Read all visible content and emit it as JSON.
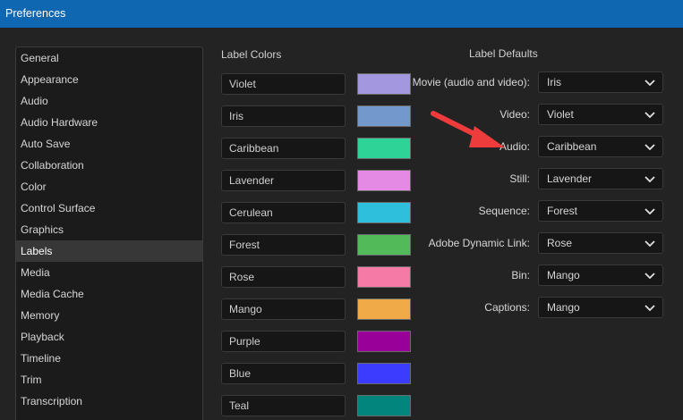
{
  "window": {
    "title": "Preferences"
  },
  "sidebar": {
    "items": [
      {
        "label": "General"
      },
      {
        "label": "Appearance"
      },
      {
        "label": "Audio"
      },
      {
        "label": "Audio Hardware"
      },
      {
        "label": "Auto Save"
      },
      {
        "label": "Collaboration"
      },
      {
        "label": "Color"
      },
      {
        "label": "Control Surface"
      },
      {
        "label": "Graphics"
      },
      {
        "label": "Labels"
      },
      {
        "label": "Media"
      },
      {
        "label": "Media Cache"
      },
      {
        "label": "Memory"
      },
      {
        "label": "Playback"
      },
      {
        "label": "Timeline"
      },
      {
        "label": "Trim"
      },
      {
        "label": "Transcription"
      }
    ],
    "selected": "Labels"
  },
  "label_colors": {
    "title": "Label Colors",
    "items": [
      {
        "name": "Violet",
        "color": "#a398e0"
      },
      {
        "name": "Iris",
        "color": "#7399cc"
      },
      {
        "name": "Caribbean",
        "color": "#2ed397"
      },
      {
        "name": "Lavender",
        "color": "#e58ae4"
      },
      {
        "name": "Cerulean",
        "color": "#2ebfdd"
      },
      {
        "name": "Forest",
        "color": "#53ba59"
      },
      {
        "name": "Rose",
        "color": "#f57aa5"
      },
      {
        "name": "Mango",
        "color": "#f0aa47"
      },
      {
        "name": "Purple",
        "color": "#990099"
      },
      {
        "name": "Blue",
        "color": "#3c3cff"
      },
      {
        "name": "Teal",
        "color": "#02857d"
      }
    ]
  },
  "label_defaults": {
    "title": "Label Defaults",
    "items": [
      {
        "label": "Movie (audio and video):",
        "value": "Iris"
      },
      {
        "label": "Video:",
        "value": "Violet"
      },
      {
        "label": "Audio:",
        "value": "Caribbean"
      },
      {
        "label": "Still:",
        "value": "Lavender"
      },
      {
        "label": "Sequence:",
        "value": "Forest"
      },
      {
        "label": "Adobe Dynamic Link:",
        "value": "Rose"
      },
      {
        "label": "Bin:",
        "value": "Mango"
      },
      {
        "label": "Captions:",
        "value": "Mango"
      }
    ]
  },
  "annotation": {
    "arrow_color": "#ee3b3b",
    "icon": "red-arrow-icon"
  }
}
